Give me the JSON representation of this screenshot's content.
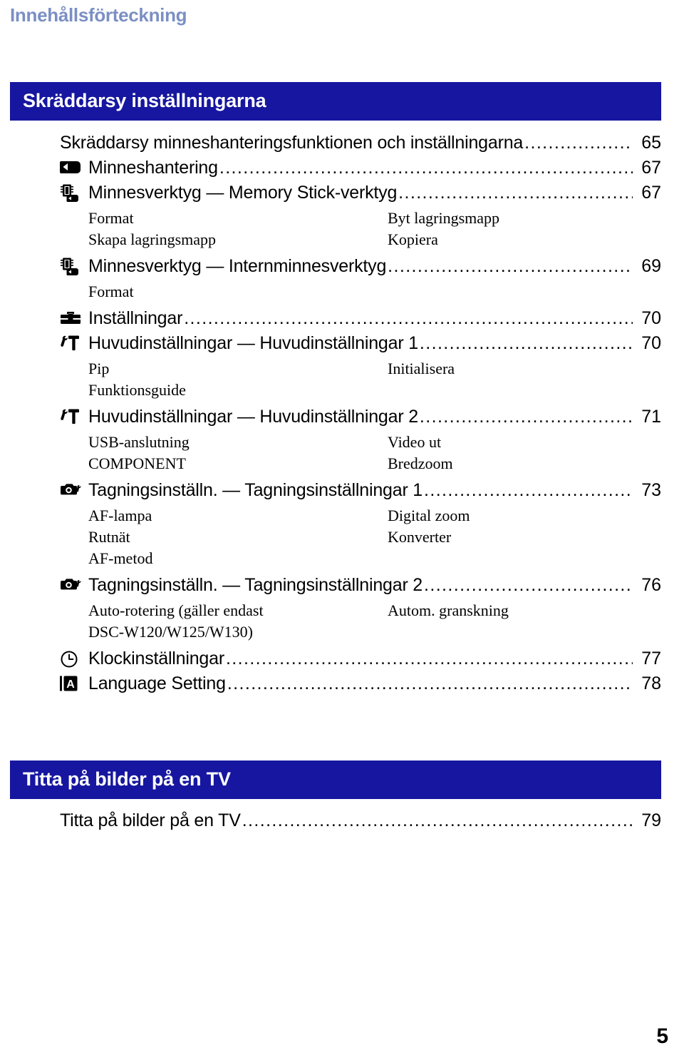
{
  "running_head": "Innehållsförteckning",
  "folio": "5",
  "sections": [
    {
      "banner": "Skräddarsy inställningarna",
      "entries": [
        {
          "icon": null,
          "title": "Skräddarsy minneshanteringsfunktionen och inställningarna",
          "page": "65",
          "subitems": []
        },
        {
          "icon": "memory-card-playback-icon",
          "title": "Minneshantering",
          "page": "67",
          "subitems": []
        },
        {
          "icon": "memory-stick-tool-icon",
          "title": "Minnesverktyg — Memory Stick-verktyg",
          "page": "67",
          "subitems": [
            {
              "left": "Format",
              "right": "Byt lagringsmapp"
            },
            {
              "left": "Skapa lagringsmapp",
              "right": "Kopiera"
            }
          ]
        },
        {
          "icon": "internal-memory-tool-icon",
          "title": "Minnesverktyg — Internminnesverktyg",
          "page": "69",
          "subitems": [
            {
              "left": "Format",
              "right": ""
            }
          ]
        },
        {
          "icon": "toolbox-icon",
          "title": "Inställningar",
          "page": "70",
          "subitems": []
        },
        {
          "icon": "wrench-hammer-icon",
          "title": "Huvudinställningar — Huvudinställningar 1",
          "page": "70",
          "subitems": [
            {
              "left": "Pip",
              "right": "Initialisera"
            },
            {
              "left": "Funktionsguide",
              "right": ""
            }
          ]
        },
        {
          "icon": "wrench-hammer-icon",
          "title": "Huvudinställningar — Huvudinställningar 2",
          "page": "71",
          "subitems": [
            {
              "left": "USB-anslutning",
              "right": "Video ut"
            },
            {
              "left": "COMPONENT",
              "right": "Bredzoom"
            }
          ]
        },
        {
          "icon": "camera-settings-icon",
          "title": "Tagningsinställn. — Tagningsinställningar 1",
          "page": "73",
          "subitems": [
            {
              "left": "AF-lampa",
              "right": "Digital zoom"
            },
            {
              "left": "Rutnät",
              "right": "Konverter"
            },
            {
              "left": "AF-metod",
              "right": ""
            }
          ]
        },
        {
          "icon": "camera-settings-icon",
          "title": "Tagningsinställn. — Tagningsinställningar 2",
          "page": "76",
          "subitems": [
            {
              "left": "Auto-rotering (gäller endast\nDSC-W120/W125/W130)",
              "right": "Autom. granskning"
            }
          ]
        },
        {
          "icon": "clock-icon",
          "title": "Klockinställningar",
          "page": "77",
          "subitems": []
        },
        {
          "icon": "language-icon",
          "title": "Language Setting",
          "page": "78",
          "subitems": []
        }
      ]
    },
    {
      "banner": "Titta på bilder på en TV",
      "entries": [
        {
          "icon": null,
          "title": "Titta på bilder på en TV",
          "page": "79",
          "subitems": []
        }
      ]
    }
  ],
  "colors": {
    "banner_background": "#1616a0",
    "banner_text": "#ffffff",
    "running_head": "#7b8fc4",
    "body_text": "#000000"
  }
}
